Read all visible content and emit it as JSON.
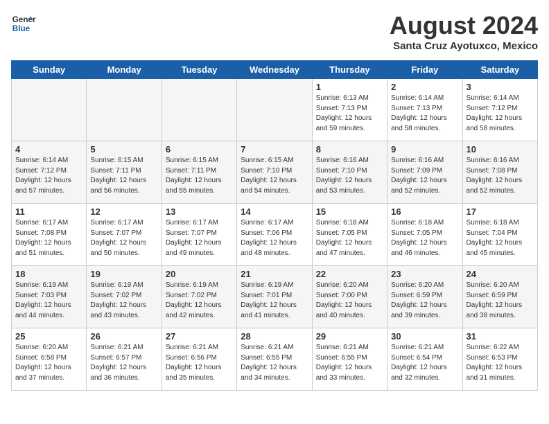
{
  "header": {
    "logo_line1": "General",
    "logo_line2": "Blue",
    "month_year": "August 2024",
    "location": "Santa Cruz Ayotuxco, Mexico"
  },
  "days_of_week": [
    "Sunday",
    "Monday",
    "Tuesday",
    "Wednesday",
    "Thursday",
    "Friday",
    "Saturday"
  ],
  "weeks": [
    [
      {
        "day": "",
        "content": ""
      },
      {
        "day": "",
        "content": ""
      },
      {
        "day": "",
        "content": ""
      },
      {
        "day": "",
        "content": ""
      },
      {
        "day": "1",
        "content": "Sunrise: 6:13 AM\nSunset: 7:13 PM\nDaylight: 12 hours\nand 59 minutes."
      },
      {
        "day": "2",
        "content": "Sunrise: 6:14 AM\nSunset: 7:13 PM\nDaylight: 12 hours\nand 58 minutes."
      },
      {
        "day": "3",
        "content": "Sunrise: 6:14 AM\nSunset: 7:12 PM\nDaylight: 12 hours\nand 58 minutes."
      }
    ],
    [
      {
        "day": "4",
        "content": "Sunrise: 6:14 AM\nSunset: 7:12 PM\nDaylight: 12 hours\nand 57 minutes."
      },
      {
        "day": "5",
        "content": "Sunrise: 6:15 AM\nSunset: 7:11 PM\nDaylight: 12 hours\nand 56 minutes."
      },
      {
        "day": "6",
        "content": "Sunrise: 6:15 AM\nSunset: 7:11 PM\nDaylight: 12 hours\nand 55 minutes."
      },
      {
        "day": "7",
        "content": "Sunrise: 6:15 AM\nSunset: 7:10 PM\nDaylight: 12 hours\nand 54 minutes."
      },
      {
        "day": "8",
        "content": "Sunrise: 6:16 AM\nSunset: 7:10 PM\nDaylight: 12 hours\nand 53 minutes."
      },
      {
        "day": "9",
        "content": "Sunrise: 6:16 AM\nSunset: 7:09 PM\nDaylight: 12 hours\nand 52 minutes."
      },
      {
        "day": "10",
        "content": "Sunrise: 6:16 AM\nSunset: 7:08 PM\nDaylight: 12 hours\nand 52 minutes."
      }
    ],
    [
      {
        "day": "11",
        "content": "Sunrise: 6:17 AM\nSunset: 7:08 PM\nDaylight: 12 hours\nand 51 minutes."
      },
      {
        "day": "12",
        "content": "Sunrise: 6:17 AM\nSunset: 7:07 PM\nDaylight: 12 hours\nand 50 minutes."
      },
      {
        "day": "13",
        "content": "Sunrise: 6:17 AM\nSunset: 7:07 PM\nDaylight: 12 hours\nand 49 minutes."
      },
      {
        "day": "14",
        "content": "Sunrise: 6:17 AM\nSunset: 7:06 PM\nDaylight: 12 hours\nand 48 minutes."
      },
      {
        "day": "15",
        "content": "Sunrise: 6:18 AM\nSunset: 7:05 PM\nDaylight: 12 hours\nand 47 minutes."
      },
      {
        "day": "16",
        "content": "Sunrise: 6:18 AM\nSunset: 7:05 PM\nDaylight: 12 hours\nand 46 minutes."
      },
      {
        "day": "17",
        "content": "Sunrise: 6:18 AM\nSunset: 7:04 PM\nDaylight: 12 hours\nand 45 minutes."
      }
    ],
    [
      {
        "day": "18",
        "content": "Sunrise: 6:19 AM\nSunset: 7:03 PM\nDaylight: 12 hours\nand 44 minutes."
      },
      {
        "day": "19",
        "content": "Sunrise: 6:19 AM\nSunset: 7:02 PM\nDaylight: 12 hours\nand 43 minutes."
      },
      {
        "day": "20",
        "content": "Sunrise: 6:19 AM\nSunset: 7:02 PM\nDaylight: 12 hours\nand 42 minutes."
      },
      {
        "day": "21",
        "content": "Sunrise: 6:19 AM\nSunset: 7:01 PM\nDaylight: 12 hours\nand 41 minutes."
      },
      {
        "day": "22",
        "content": "Sunrise: 6:20 AM\nSunset: 7:00 PM\nDaylight: 12 hours\nand 40 minutes."
      },
      {
        "day": "23",
        "content": "Sunrise: 6:20 AM\nSunset: 6:59 PM\nDaylight: 12 hours\nand 39 minutes."
      },
      {
        "day": "24",
        "content": "Sunrise: 6:20 AM\nSunset: 6:59 PM\nDaylight: 12 hours\nand 38 minutes."
      }
    ],
    [
      {
        "day": "25",
        "content": "Sunrise: 6:20 AM\nSunset: 6:58 PM\nDaylight: 12 hours\nand 37 minutes."
      },
      {
        "day": "26",
        "content": "Sunrise: 6:21 AM\nSunset: 6:57 PM\nDaylight: 12 hours\nand 36 minutes."
      },
      {
        "day": "27",
        "content": "Sunrise: 6:21 AM\nSunset: 6:56 PM\nDaylight: 12 hours\nand 35 minutes."
      },
      {
        "day": "28",
        "content": "Sunrise: 6:21 AM\nSunset: 6:55 PM\nDaylight: 12 hours\nand 34 minutes."
      },
      {
        "day": "29",
        "content": "Sunrise: 6:21 AM\nSunset: 6:55 PM\nDaylight: 12 hours\nand 33 minutes."
      },
      {
        "day": "30",
        "content": "Sunrise: 6:21 AM\nSunset: 6:54 PM\nDaylight: 12 hours\nand 32 minutes."
      },
      {
        "day": "31",
        "content": "Sunrise: 6:22 AM\nSunset: 6:53 PM\nDaylight: 12 hours\nand 31 minutes."
      }
    ]
  ]
}
